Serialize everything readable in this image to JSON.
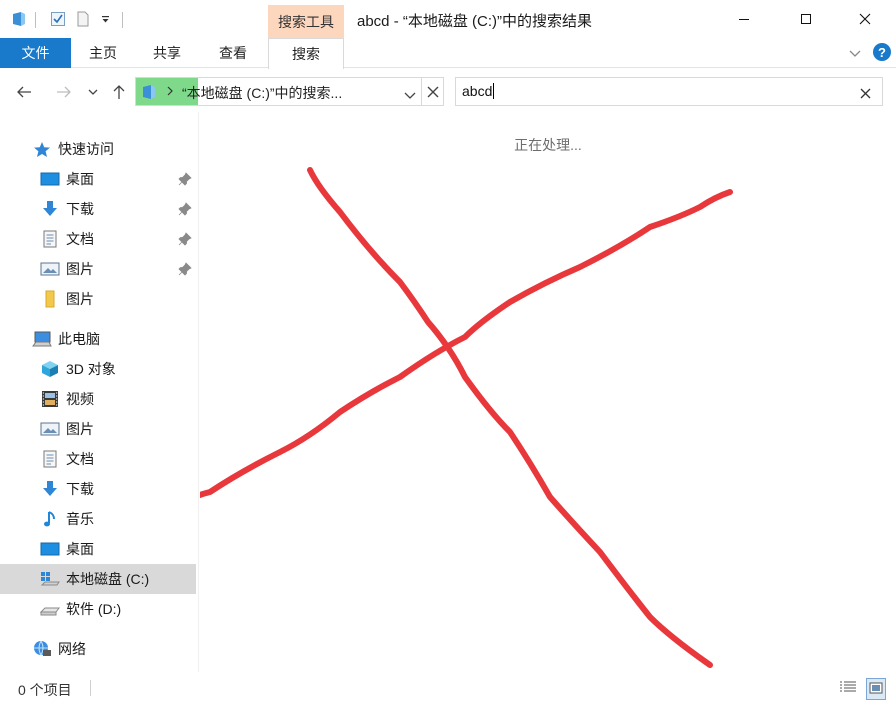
{
  "window": {
    "title": "abcd - “本地磁盘 (C:)”中的搜索结果",
    "context_group": "搜索工具",
    "controls": {
      "minimize": "minimize-icon",
      "maximize": "maximize-icon",
      "close": "close-icon"
    }
  },
  "ribbon": {
    "tabs": [
      {
        "label": "文件",
        "active": false
      },
      {
        "label": "主页",
        "active": false
      },
      {
        "label": "共享",
        "active": false
      },
      {
        "label": "查看",
        "active": false
      },
      {
        "label": "搜索",
        "active": true
      }
    ]
  },
  "address": {
    "path": "“本地磁盘 (C:)”中的搜索..."
  },
  "search": {
    "value": "abcd"
  },
  "nav": {
    "quick_access": {
      "label": "快速访问",
      "items": [
        {
          "label": "桌面",
          "pinned": true
        },
        {
          "label": "下载",
          "pinned": true
        },
        {
          "label": "文档",
          "pinned": true
        },
        {
          "label": "图片",
          "pinned": true
        },
        {
          "label": "图片",
          "pinned": false
        }
      ]
    },
    "this_pc": {
      "label": "此电脑",
      "items": [
        {
          "label": "3D 对象"
        },
        {
          "label": "视频"
        },
        {
          "label": "图片"
        },
        {
          "label": "文档"
        },
        {
          "label": "下载"
        },
        {
          "label": "音乐"
        },
        {
          "label": "桌面"
        },
        {
          "label": "本地磁盘 (C:)",
          "selected": true
        },
        {
          "label": "软件 (D:)"
        }
      ]
    },
    "network": {
      "label": "网络"
    }
  },
  "content": {
    "status_text": "正在处理..."
  },
  "statusbar": {
    "count": "0 个项目"
  },
  "colors": {
    "accent": "#1979ca",
    "context_tab": "#fcd6bd",
    "address_highlight": "#7fd98a",
    "annotation_x": "#e8383b",
    "selection": "#d9d9d9"
  }
}
